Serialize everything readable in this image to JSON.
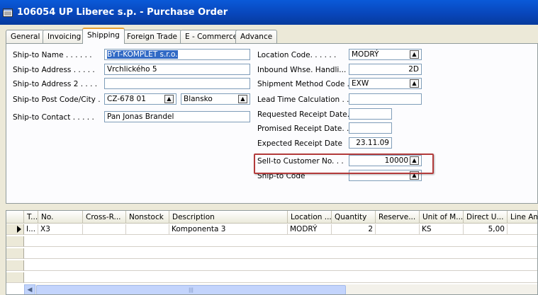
{
  "window": {
    "title": "106054 UP Liberec s.p. - Purchase Order"
  },
  "tabs": [
    {
      "label": "General"
    },
    {
      "label": "Invoicing"
    },
    {
      "label": "Shipping"
    },
    {
      "label": "Foreign Trade"
    },
    {
      "label": "E - Commerce"
    },
    {
      "label": "Advance"
    }
  ],
  "left": {
    "ship_to_name_label": "Ship-to Name . . . . . .",
    "ship_to_name": "BYT-KOMPLET s.r.o.",
    "ship_to_address_label": "Ship-to Address . . . . .",
    "ship_to_address": "Vrchlického 5",
    "ship_to_address2_label": "Ship-to Address 2 . . . .",
    "ship_to_address2": "",
    "post_city_label": "Ship-to Post Code/City .",
    "post_code": "CZ-678 01",
    "city": "Blansko",
    "contact_label": "Ship-to Contact . . . . .",
    "contact": "Pan Jonas Brandel"
  },
  "right": {
    "location_label": "Location Code. . . . . .",
    "location": "MODRÝ",
    "inbound_label": "Inbound Whse. Handli...",
    "inbound": "2D",
    "shipment_label": "Shipment Method Code .",
    "shipment": "EXW",
    "lead_label": "Lead Time Calculation . .",
    "lead": "",
    "requested_label": "Requested Receipt Date.",
    "requested": "",
    "promised_label": "Promised Receipt Date. .",
    "promised": "",
    "expected_label": "Expected Receipt Date",
    "expected": "23.11.09",
    "sell_to_label": "Sell-to Customer No. . .",
    "sell_to": "10000",
    "ship_to_code_label": "Ship-to Code",
    "ship_to_code": ""
  },
  "lines": {
    "headers": [
      "T...",
      "No.",
      "Cross-R...",
      "Nonstock",
      "Description",
      "Location ...",
      "Quantity",
      "Reserve...",
      "Unit of M...",
      "Direct U...",
      "Line Amo"
    ],
    "rows": [
      [
        "I...",
        "X3",
        "",
        "",
        "Komponenta 3",
        "MODRÝ",
        "2",
        "",
        "KS",
        "5,00",
        ""
      ]
    ]
  },
  "colors": {
    "titlebar": "#0845b8",
    "highlight": "#b33b3b",
    "tab_accent": "#e8a032"
  }
}
